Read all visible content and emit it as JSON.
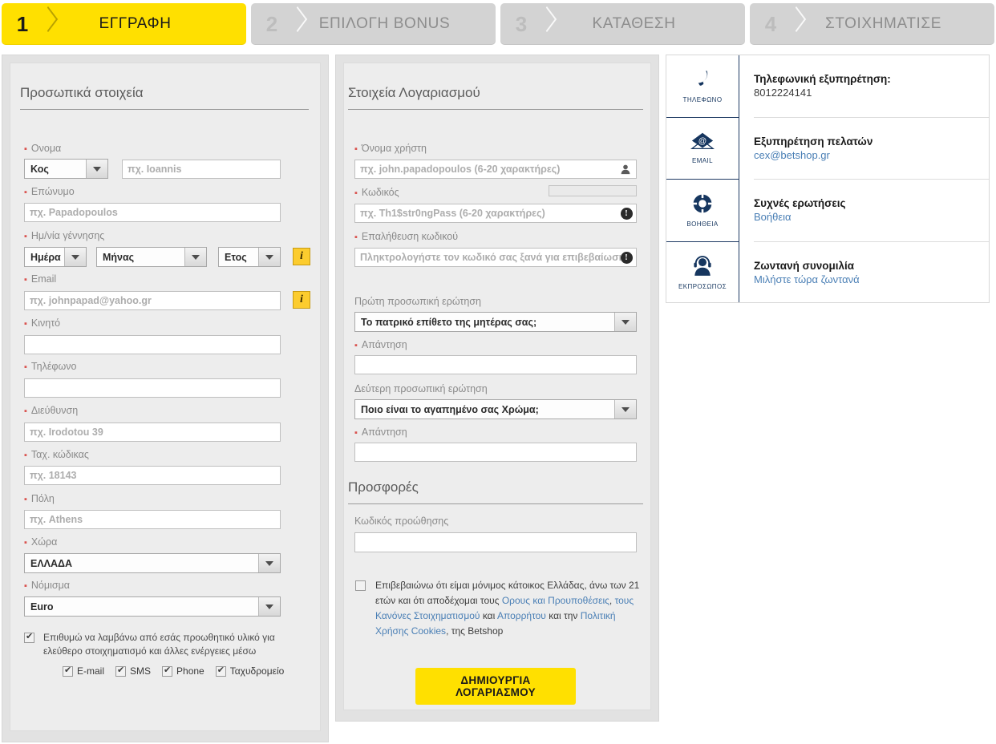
{
  "steps": [
    {
      "num": "1",
      "label": "ΕΓΓΡΑΦΗ",
      "active": true
    },
    {
      "num": "2",
      "label": "ΕΠΙΛΟΓΗ BONUS",
      "active": false
    },
    {
      "num": "3",
      "label": "ΚΑΤΑΘΕΣΗ",
      "active": false
    },
    {
      "num": "4",
      "label": "ΣΤΟΙΧΗΜΑΤΙΣΕ",
      "active": false
    }
  ],
  "personal": {
    "title": "Προσωπικά στοιχεία",
    "name_label": "Ονομα",
    "title_select": "Κος",
    "name_placeholder": "πχ. Ioannis",
    "surname_label": "Επώνυμο",
    "surname_placeholder": "πχ. Papadopoulos",
    "dob_label": "Ημ/νία γέννησης",
    "day_select": "Ημέρα",
    "month_select": "Μήνας",
    "year_select": "Ετος",
    "email_label": "Email",
    "email_placeholder": "πχ. johnpapad@yahoo.gr",
    "mobile_label": "Κινητό",
    "mobile_value": "",
    "phone_label": "Τηλέφωνο",
    "phone_value": "",
    "address_label": "Διεύθυνση",
    "address_placeholder": "πχ. Irodotou 39",
    "zip_label": "Ταχ. κώδικας",
    "zip_placeholder": "πχ. 18143",
    "city_label": "Πόλη",
    "city_placeholder": "πχ. Athens",
    "country_label": "Χώρα",
    "country_select": "ΕΛΛΑΔΑ",
    "currency_label": "Νόμισμα",
    "currency_select": "Euro",
    "info_icon": "i",
    "promo_text": "Επιθυμώ να λαμβάνω από εσάς προωθητικό υλικό για ελεύθερο στοιχηματισμό και άλλες ενέργειες μέσω",
    "promo_options": [
      {
        "label": "E-mail",
        "checked": true
      },
      {
        "label": "SMS",
        "checked": true
      },
      {
        "label": "Phone",
        "checked": true
      },
      {
        "label": "Ταχυδρομείο",
        "checked": true
      }
    ],
    "promo_checked": true
  },
  "account": {
    "title": "Στοιχεία Λογαριασμού",
    "username_label": "Όνομα χρήστη",
    "username_placeholder": "πχ. john.papadopoulos (6-20 χαρακτήρες)",
    "username_icon": "user-icon",
    "password_label": "Κωδικός",
    "password_placeholder": "πχ. Th1$str0ngPass (6-20 χαρακτήρες)",
    "password_icon": "info-dot-icon",
    "confirm_label": "Επαλήθευση κωδικού",
    "confirm_placeholder": "Πληκτρολογήστε τον κωδικό σας ξανά για επιβεβαίωση",
    "confirm_icon": "info-dot-icon",
    "q1_label": "Πρώτη προσωπική ερώτηση",
    "q1_select": "Το πατρικό επίθετο της μητέρας σας;",
    "a1_label": "Απάντηση",
    "a1_value": "",
    "q2_label": "Δεύτερη προσωπική ερώτηση",
    "q2_select": "Ποιο είναι το αγαπημένο σας Χρώμα;",
    "a2_label": "Απάντηση",
    "a2_value": ""
  },
  "offers": {
    "title": "Προσφορές",
    "promo_code_label": "Κωδικός προώθησης",
    "promo_code_value": "",
    "terms_checked": false,
    "terms": {
      "p1": "Επιβεβαιώνω ότι είμαι μόνιμος κάτοικος Ελλάδας, άνω των 21 ετών και ότι αποδέχομαι τους ",
      "link1": "Ορους και Προυποθέσεις",
      "p2": ", ",
      "link2": "τους Κανόνες Στοιχηματισμού",
      "p3": " και ",
      "link3": "Απορρήτου",
      "p4": " και την ",
      "link4": "Πολιτική Χρήσης Cookies",
      "p5": ", της Betshop"
    },
    "submit_label": "ΔΗΜΙΟΥΡΓΙΑ ΛΟΓΑΡΙΑΣΜΟΥ"
  },
  "sidebar": {
    "items": [
      {
        "icon": "phone-icon",
        "caption": "ΤΗΛΕΦΩΝΟ",
        "title": "Τηλεφωνική εξυπηρέτηση:",
        "sub": "8012224141",
        "sub_is_link": false
      },
      {
        "icon": "email-icon",
        "caption": "EMAIL",
        "title": "Εξυπηρέτηση πελατών",
        "sub": "cex@betshop.gr",
        "sub_is_link": true
      },
      {
        "icon": "lifebuoy-icon",
        "caption": "ΒΟΗΘΕΙΑ",
        "title": "Συχνές ερωτήσεις",
        "sub": "Βοήθεια",
        "sub_is_link": true
      },
      {
        "icon": "headset-icon",
        "caption": "ΕΚΠΡΟΣΩΠΟΣ",
        "title": "Ζωντανή συνομιλία",
        "sub": "Μιλήστε τώρα ζωντανά",
        "sub_is_link": true
      }
    ]
  },
  "colors": {
    "brand_yellow": "#ffe000",
    "link_blue": "#4a7fb5",
    "navy": "#16365f",
    "required_red": "#d9534f"
  }
}
